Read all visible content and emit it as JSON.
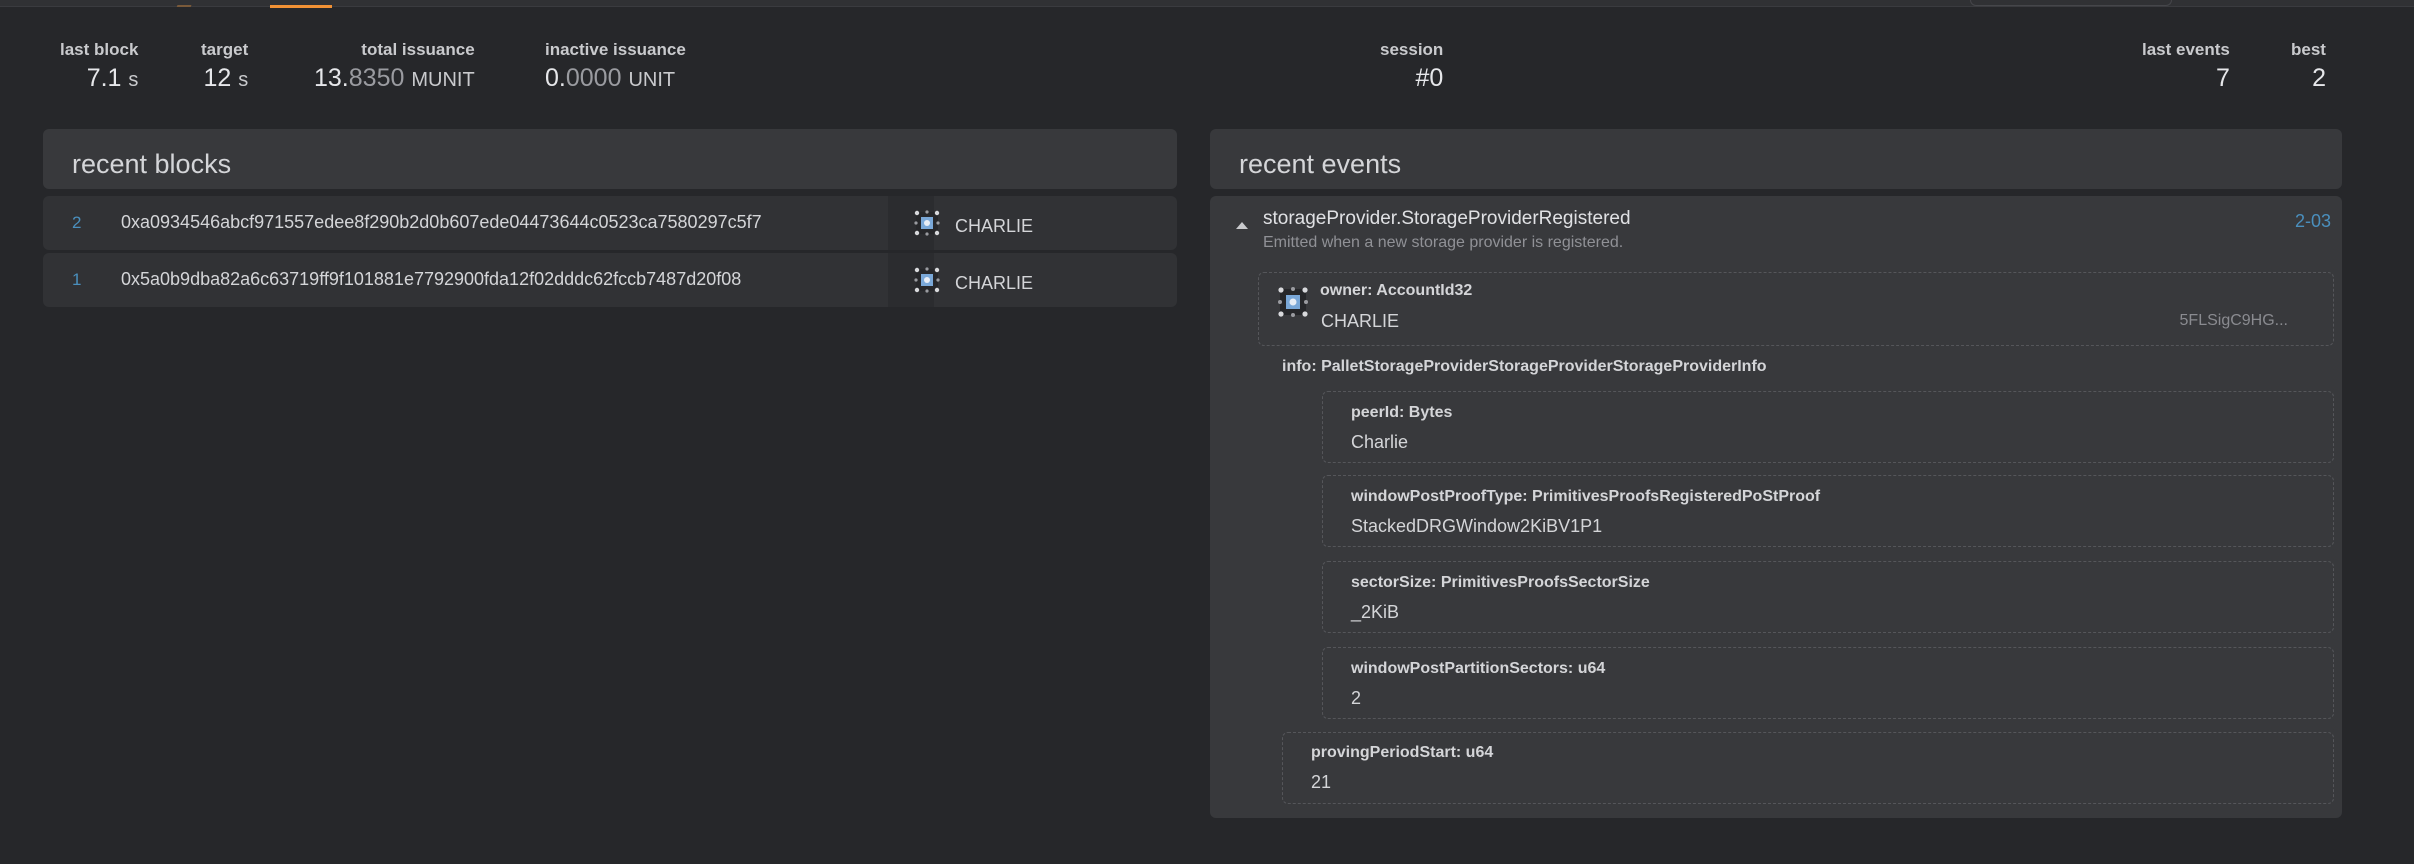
{
  "summary": {
    "last_block": {
      "label": "last block",
      "value": "7.1",
      "unit": "s"
    },
    "target": {
      "label": "target",
      "value": "12",
      "unit": "s"
    },
    "total_issuance": {
      "label": "total issuance",
      "value_main": "13.",
      "value_dim": "8350",
      "unit": "MUNIT"
    },
    "inactive_issuance": {
      "label": "inactive issuance",
      "value_main": "0.",
      "value_dim": "0000",
      "unit": "UNIT"
    },
    "session": {
      "label": "session",
      "value": "#0"
    },
    "last_events": {
      "label": "last events",
      "value": "7"
    },
    "best": {
      "label": "best",
      "value": "2"
    }
  },
  "recent_blocks": {
    "title": "recent blocks",
    "items": [
      {
        "number": "2",
        "hash": "0xa0934546abcf971557edee8f290b2d0b607ede04473644c0523ca7580297c5f7",
        "author": "CHARLIE"
      },
      {
        "number": "1",
        "hash": "0x5a0b9dba82a6c63719ff9f101881e7792900fda12f02dddc62fccb7487d20f08",
        "author": "CHARLIE"
      }
    ]
  },
  "recent_events": {
    "title": "recent events",
    "event": {
      "name": "storageProvider.StorageProviderRegistered",
      "description": "Emitted when a new storage provider is registered.",
      "id": "2-03",
      "owner": {
        "label": "owner: AccountId32",
        "value": "CHARLIE",
        "address": "5FLSigC9HG..."
      },
      "info_label": "info: PalletStorageProviderStorageProviderStorageProviderInfo",
      "info_fields": [
        {
          "label": "peerId: Bytes",
          "value": "Charlie"
        },
        {
          "label": "windowPostProofType: PrimitivesProofsRegisteredPoStProof",
          "value": "StackedDRGWindow2KiBV1P1"
        },
        {
          "label": "sectorSize: PrimitivesProofsSectorSize",
          "value": "_2KiB"
        },
        {
          "label": "windowPostPartitionSectors: u64",
          "value": "2"
        }
      ],
      "proving": {
        "label": "provingPeriodStart: u64",
        "value": "21"
      }
    }
  },
  "colors": {
    "accent": "#f19135",
    "link": "#4a8fbd",
    "background": "#26272a",
    "panel": "#38393c"
  }
}
